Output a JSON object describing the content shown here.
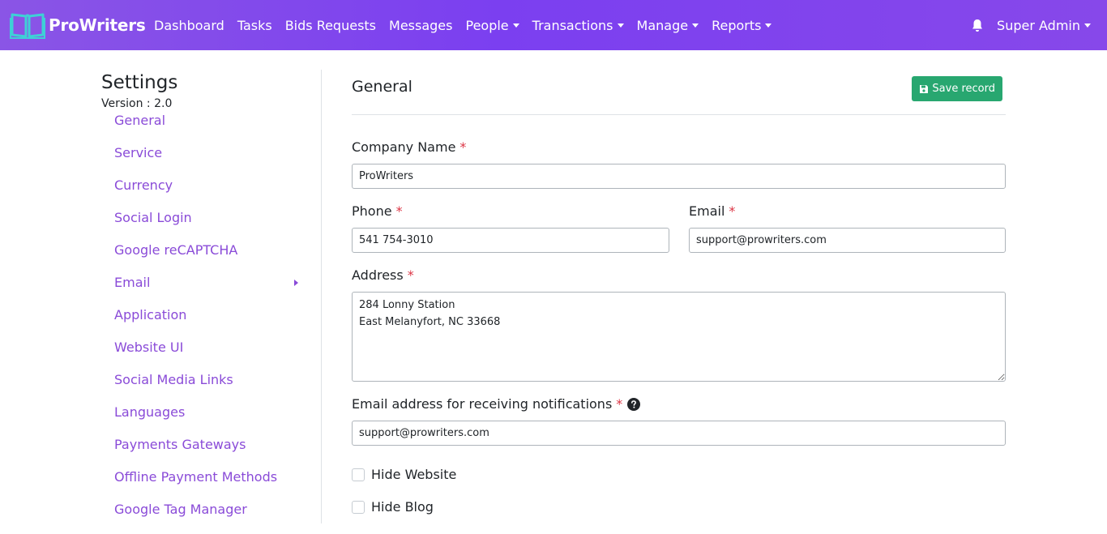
{
  "brand": {
    "name": "ProWriters"
  },
  "nav": {
    "links": [
      {
        "label": "Dashboard",
        "dropdown": false
      },
      {
        "label": "Tasks",
        "dropdown": false
      },
      {
        "label": "Bids Requests",
        "dropdown": false
      },
      {
        "label": "Messages",
        "dropdown": false
      },
      {
        "label": "People",
        "dropdown": true
      },
      {
        "label": "Transactions",
        "dropdown": true
      },
      {
        "label": "Manage",
        "dropdown": true
      },
      {
        "label": "Reports",
        "dropdown": true
      }
    ],
    "user": "Super Admin"
  },
  "sidebar": {
    "title": "Settings",
    "version": "Version : 2.0",
    "items": [
      {
        "label": "General"
      },
      {
        "label": "Service"
      },
      {
        "label": "Currency"
      },
      {
        "label": "Social Login"
      },
      {
        "label": "Google reCAPTCHA"
      },
      {
        "label": "Email",
        "has_submenu": true
      },
      {
        "label": "Application"
      },
      {
        "label": "Website UI"
      },
      {
        "label": "Social Media Links"
      },
      {
        "label": "Languages"
      },
      {
        "label": "Payments Gateways"
      },
      {
        "label": "Offline Payment Methods"
      },
      {
        "label": "Google Tag Manager"
      }
    ]
  },
  "main": {
    "title": "General",
    "save_label": "Save record",
    "fields": {
      "company_name": {
        "label": "Company Name",
        "value": "ProWriters"
      },
      "phone": {
        "label": "Phone",
        "value": "541 754-3010"
      },
      "email": {
        "label": "Email",
        "value": "support@prowriters.com"
      },
      "address": {
        "label": "Address",
        "value": "284 Lonny Station\nEast Melanyfort, NC 33668"
      },
      "notification_email": {
        "label": "Email address for receiving notifications",
        "value": "support@prowriters.com"
      }
    },
    "required_marker": "*",
    "checkboxes": {
      "hide_website": {
        "label": "Hide Website",
        "checked": false
      },
      "hide_blog": {
        "label": "Hide Blog",
        "checked": false
      }
    }
  },
  "colors": {
    "nav_gradient_start": "#8a55e6",
    "nav_gradient_end": "#7b3ff0",
    "link_purple": "#8a4bd8",
    "save_green": "#28a770",
    "required_red": "#dc3545",
    "logo_cyan": "#3ed0d6"
  }
}
